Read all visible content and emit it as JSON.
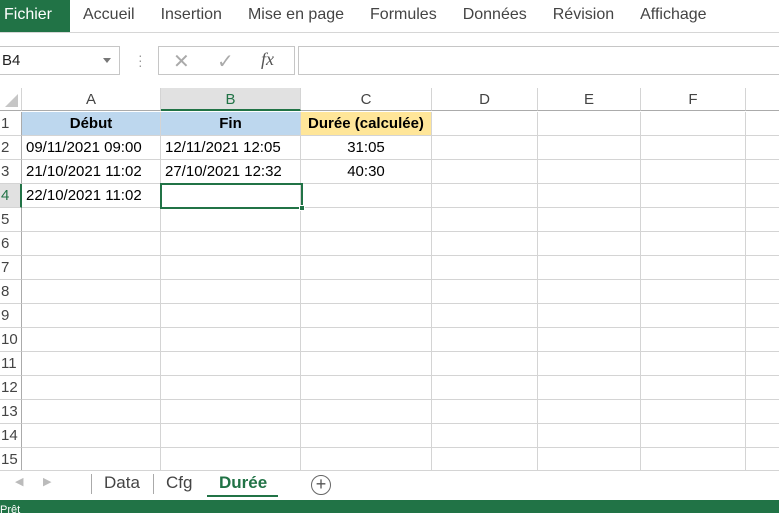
{
  "ribbon": {
    "tabs": [
      "Fichier",
      "Accueil",
      "Insertion",
      "Mise en page",
      "Formules",
      "Données",
      "Révision",
      "Affichage"
    ]
  },
  "formula_bar": {
    "name_box": "B4",
    "cancel_icon": "✕",
    "enter_icon": "✓",
    "fx_label": "fx",
    "value": ""
  },
  "columns": [
    "A",
    "B",
    "C",
    "D",
    "E",
    "F"
  ],
  "rows": [
    "1",
    "2",
    "3",
    "4",
    "5",
    "6",
    "7",
    "8",
    "9",
    "10",
    "11",
    "12",
    "13",
    "14",
    "15"
  ],
  "cells": [
    [
      "Début",
      "Fin",
      "Durée (calculée)"
    ],
    [
      "09/11/2021 09:00",
      "12/11/2021 12:05",
      "31:05"
    ],
    [
      "21/10/2021 11:02",
      "27/10/2021 12:32",
      "40:30"
    ],
    [
      "22/10/2021 11:02",
      "",
      ""
    ]
  ],
  "sheets": [
    "Data",
    "Cfg",
    "Durée"
  ],
  "active_sheet": "Durée",
  "status": {
    "text": "Prêt"
  },
  "colors": {
    "accent": "#217346",
    "header_blue": "#bdd7ee",
    "header_yellow": "#ffe699"
  }
}
